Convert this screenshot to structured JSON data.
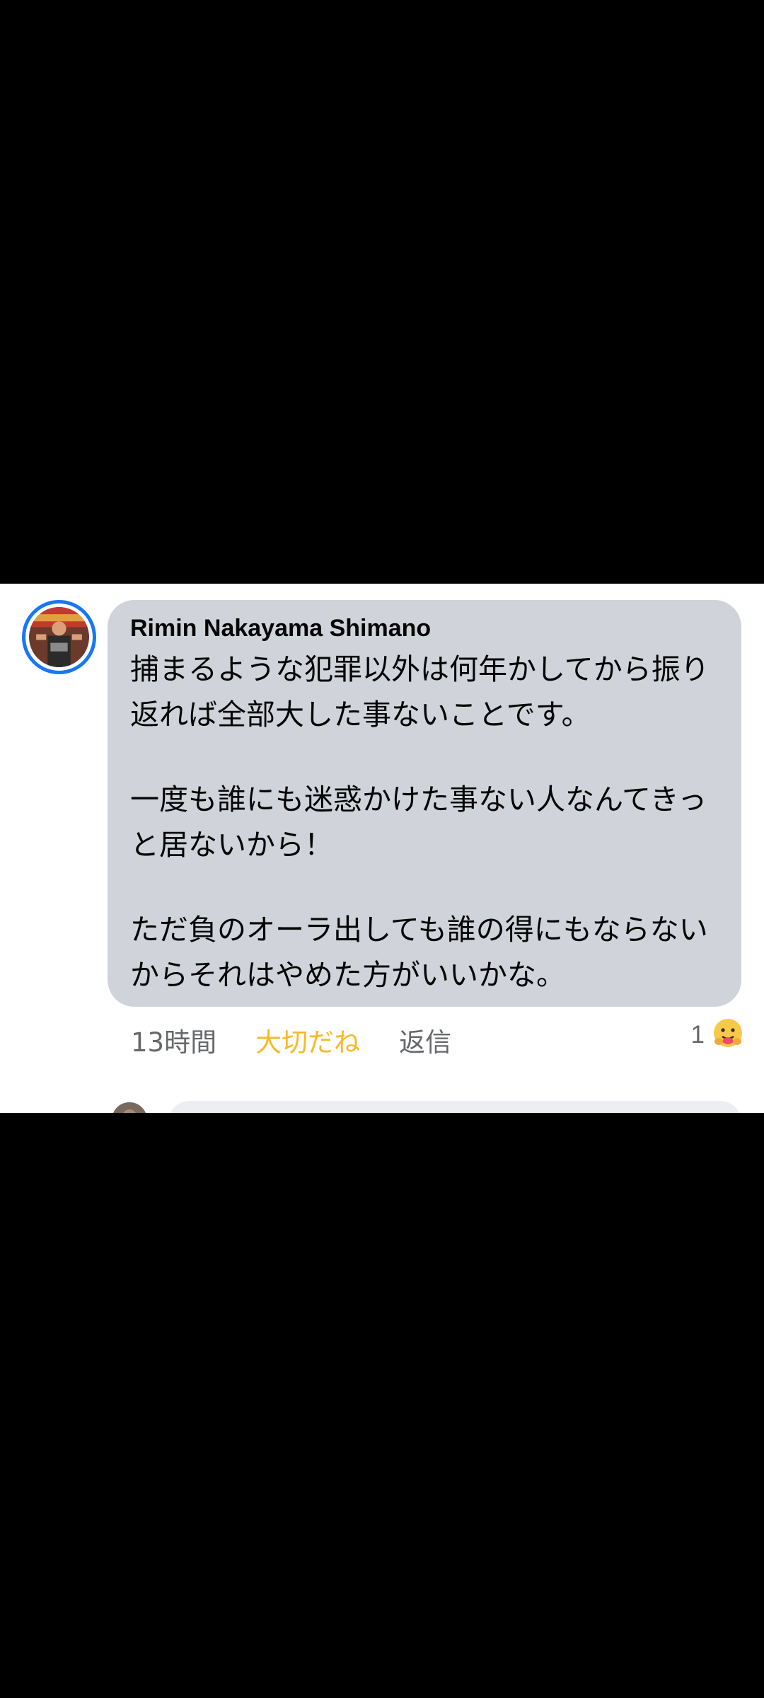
{
  "comment": {
    "author": "Rimin Nakayama Shimano",
    "paragraphs": [
      "捕まるような犯罪以外は何年かしてから振り返れば全部大した事ないことです。",
      "一度も誰にも迷惑かけた事ない人なんてきっと居ないから！",
      "ただ負のオーラ出しても誰の得にもならないからそれはやめた方がいいかな。"
    ],
    "time": "13時間",
    "like_label": "大切だね",
    "reply_label": "返信",
    "reaction_count": "1",
    "reaction_icon": "care-hug-emoji-icon"
  },
  "colors": {
    "bubble": "#d0d3d9",
    "like_active": "#f7b928",
    "meta_text": "#65676b",
    "avatar_ring": "#1877f2"
  }
}
